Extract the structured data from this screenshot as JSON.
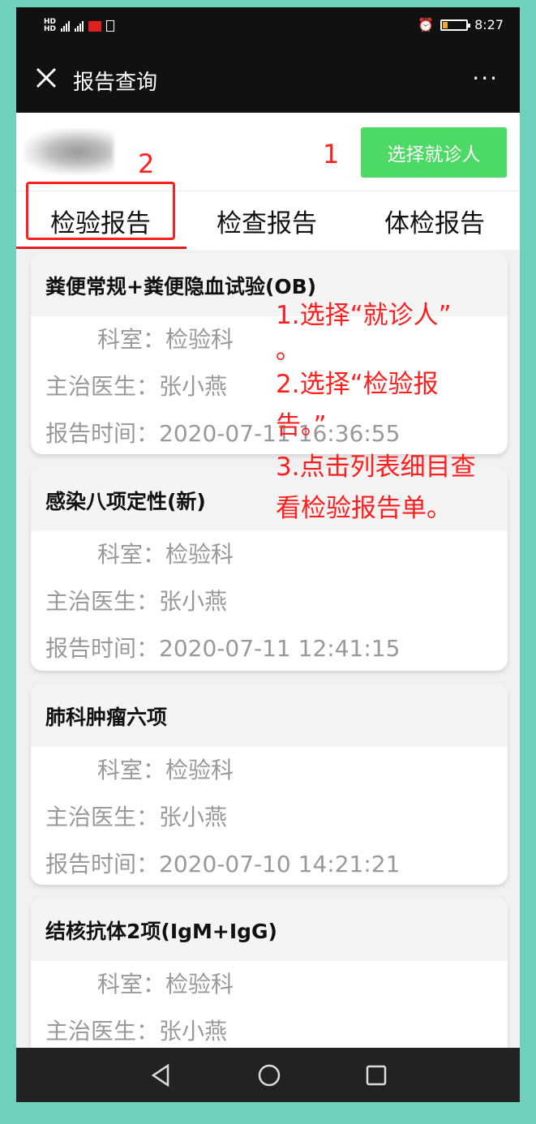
{
  "status_bar": {
    "time": "8:27"
  },
  "header": {
    "title": "报告查询",
    "more": "···"
  },
  "patient": {
    "select_button": "选择就诊人"
  },
  "annotations": {
    "num1": "1",
    "num2": "2",
    "steps": [
      "1.选择“就诊人”",
      "。",
      "2.选择“检验报",
      "告。”",
      "3.点击列表细目查",
      "看检验报告单。"
    ]
  },
  "tabs": [
    {
      "label": "检验报告"
    },
    {
      "label": "检查报告"
    },
    {
      "label": "体检报告"
    }
  ],
  "labels": {
    "dept": "科室：",
    "doctor": "主治医生：",
    "time": "报告时间："
  },
  "reports": [
    {
      "title": "粪便常规+粪便隐血试验(OB)",
      "dept": "检验科",
      "doctor": "张小燕",
      "time": "2020-07-11 16:36:55"
    },
    {
      "title": "感染八项定性(新)",
      "dept": "检验科",
      "doctor": "张小燕",
      "time": "2020-07-11 12:41:15"
    },
    {
      "title": "肺科肿瘤六项",
      "dept": "检验科",
      "doctor": "张小燕",
      "time": "2020-07-10 14:21:21"
    },
    {
      "title": "结核抗体2项(IgM+IgG)",
      "dept": "检验科",
      "doctor": "张小燕"
    }
  ],
  "colors": {
    "accent_green": "#4cd964",
    "annotation_red": "#ff1e1e",
    "frame": "#6fd1bd"
  }
}
